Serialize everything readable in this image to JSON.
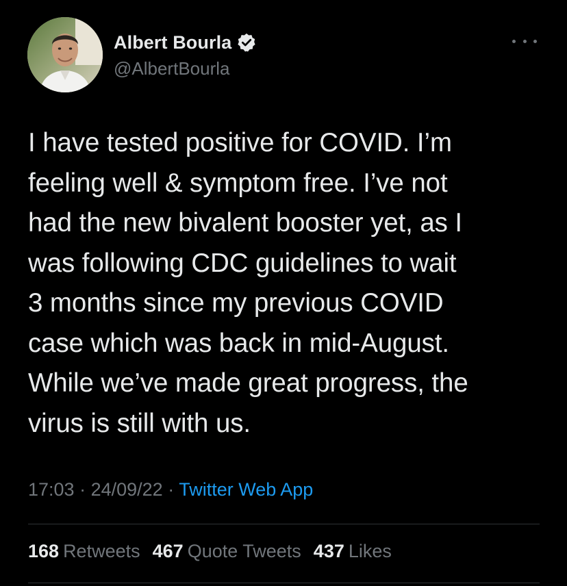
{
  "profile": {
    "name": "Albert Bourla",
    "handle": "@AlbertBourla",
    "verified": true
  },
  "tweet": {
    "text": "I have tested positive for COVID. I’m\nfeeling well & symptom free. I’ve not\nhad the new bivalent booster yet, as I\nwas following CDC guidelines to wait\n3 months since my previous COVID\ncase which was back in mid-August.\nWhile we’ve made great progress, the\nvirus is still with us.",
    "time": "17:03",
    "separator": " · ",
    "date": "24/09/22",
    "source": "Twitter Web App"
  },
  "stats": [
    {
      "count": "168",
      "label": "Retweets"
    },
    {
      "count": "467",
      "label": "Quote Tweets"
    },
    {
      "count": "437",
      "label": "Likes"
    }
  ],
  "icons": {
    "verified": "verified-badge-icon",
    "more": "more-options-icon"
  },
  "colors": {
    "background": "#000000",
    "text": "#e7e9ea",
    "secondary": "#71767b",
    "link": "#1d9bf0",
    "divider": "#2f3336"
  }
}
